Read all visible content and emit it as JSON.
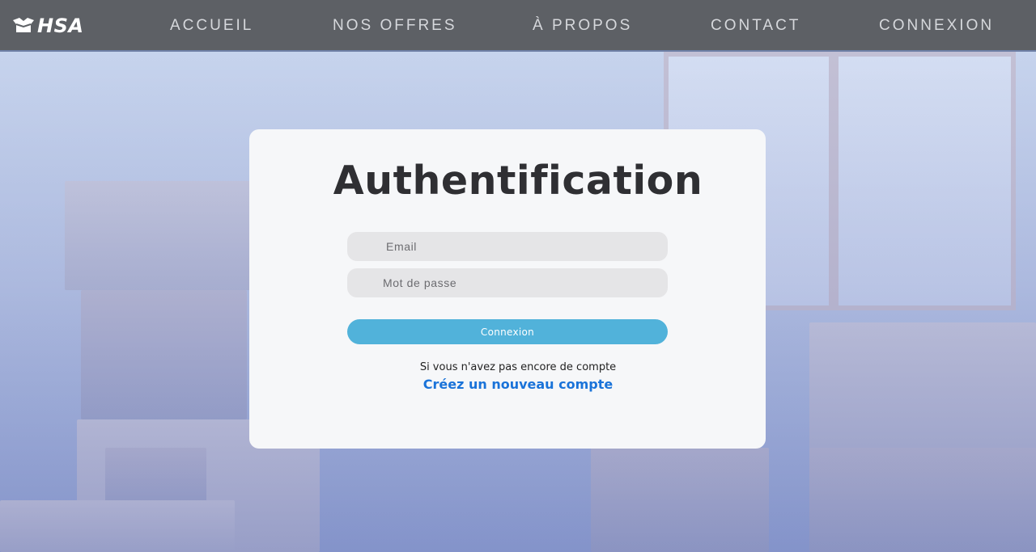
{
  "brand": {
    "logo_icon": "box-icon",
    "name": "HSA"
  },
  "nav": {
    "items": [
      {
        "label": "ACCUEIL"
      },
      {
        "label": "NOS OFFRES"
      },
      {
        "label": "À PROPOS"
      },
      {
        "label": "CONTACT"
      },
      {
        "label": "CONNEXION"
      }
    ]
  },
  "auth": {
    "title": "Authentification",
    "email_placeholder": "Email",
    "password_placeholder": "Mot de passe",
    "submit_label": "Connexion",
    "hint": "Si vous n'avez pas encore de compte",
    "signup_link": "Créez un nouveau compte"
  },
  "colors": {
    "navbar": "#5d6065",
    "card": "#f6f7f9",
    "button": "#51b2da",
    "link": "#1a73d9"
  }
}
